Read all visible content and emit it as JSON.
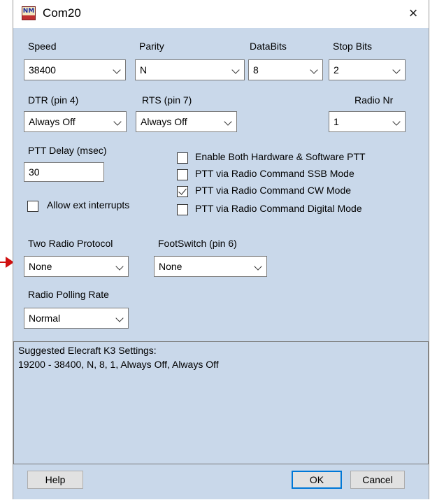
{
  "window": {
    "title": "Com20",
    "icon": "nm-app-icon",
    "close": "×"
  },
  "serial": {
    "speed": {
      "label": "Speed",
      "value": "38400"
    },
    "parity": {
      "label": "Parity",
      "value": "N"
    },
    "databits": {
      "label": "DataBits",
      "value": "8"
    },
    "stopbits": {
      "label": "Stop Bits",
      "value": "2"
    },
    "dtr": {
      "label": "DTR (pin 4)",
      "value": "Always Off"
    },
    "rts": {
      "label": "RTS (pin 7)",
      "value": "Always Off"
    },
    "radio_nr": {
      "label": "Radio Nr",
      "value": "1"
    }
  },
  "ptt": {
    "delay_label": "PTT Delay  (msec)",
    "delay_value": "30",
    "options": [
      {
        "label": "Enable Both Hardware & Software PTT",
        "checked": false
      },
      {
        "label": "PTT via Radio Command SSB Mode",
        "checked": false
      },
      {
        "label": "PTT via Radio Command CW Mode",
        "checked": true
      },
      {
        "label": "PTT via Radio Command Digital Mode",
        "checked": false
      }
    ]
  },
  "allow_ext": {
    "label": "Allow ext interrupts",
    "checked": false
  },
  "two_radio": {
    "label": "Two Radio Protocol",
    "value": "None"
  },
  "footswitch": {
    "label": "FootSwitch (pin 6)",
    "value": "None"
  },
  "polling": {
    "label": "Radio Polling Rate",
    "value": "Normal"
  },
  "suggested": {
    "line1": "Suggested Elecraft K3 Settings:",
    "line2": "19200 - 38400, N, 8, 1, Always Off, Always Off"
  },
  "buttons": {
    "help": "Help",
    "ok": "OK",
    "cancel": "Cancel"
  },
  "colors": {
    "client_bg": "#c9d8ea",
    "accent": "#0078d7",
    "annotation_arrow": "#d01010"
  }
}
